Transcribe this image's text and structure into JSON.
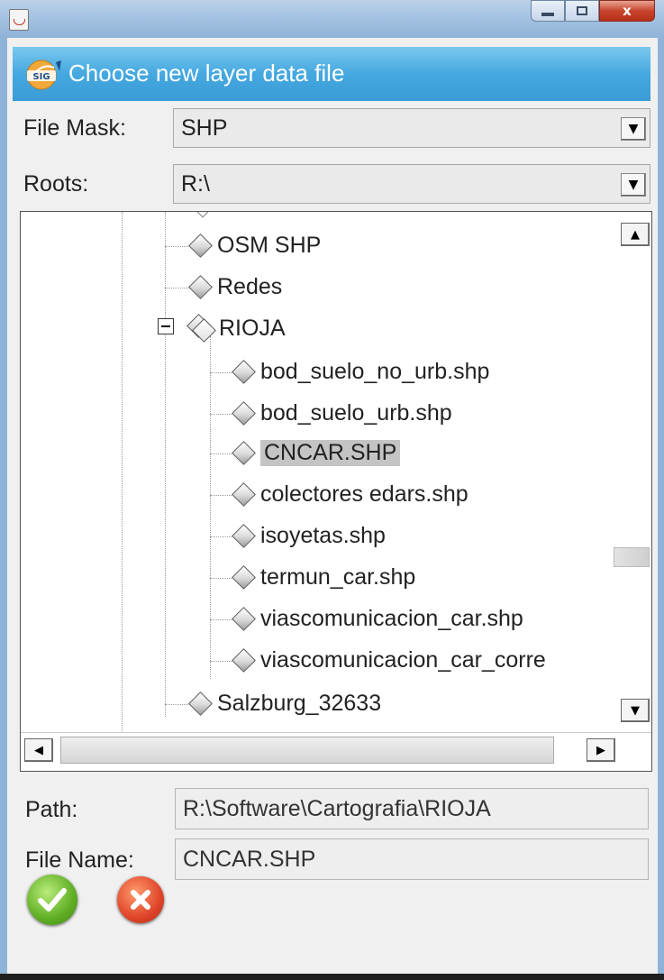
{
  "window": {
    "controls": {
      "minimize": "minimize-icon",
      "maximize": "maximize-icon",
      "close": "close-icon",
      "close_glyph": "x"
    }
  },
  "dialog": {
    "title": "Choose new layer data file",
    "logo_text": "SIG"
  },
  "filters": {
    "file_mask_label": "File Mask:",
    "file_mask_value": "SHP",
    "roots_label": "Roots:",
    "roots_value": "R:\\"
  },
  "tree": {
    "items": [
      {
        "label": "OSM SHP",
        "level": 1
      },
      {
        "label": "Redes",
        "level": 1
      },
      {
        "label": "RIOJA",
        "level": 1,
        "expanded": true
      },
      {
        "label": "bod_suelo_no_urb.shp",
        "level": 2
      },
      {
        "label": "bod_suelo_urb.shp",
        "level": 2
      },
      {
        "label": "CNCAR.SHP",
        "level": 2,
        "selected": true
      },
      {
        "label": "colectores edars.shp",
        "level": 2
      },
      {
        "label": "isoyetas.shp",
        "level": 2
      },
      {
        "label": "termun_car.shp",
        "level": 2
      },
      {
        "label": "viascomunicacion_car.shp",
        "level": 2
      },
      {
        "label": "viascomunicacion_car_corre",
        "level": 2
      },
      {
        "label": "Salzburg_32633",
        "level": 1
      }
    ],
    "scroll": {
      "up": "▲",
      "down": "▼",
      "left": "◀",
      "right": "▶"
    }
  },
  "path": {
    "label": "Path:",
    "value": "R:\\Software\\Cartografia\\RIOJA"
  },
  "file_name": {
    "label": "File Name:",
    "value": "CNCAR.SHP"
  },
  "actions": {
    "ok_icon": "check-icon",
    "cancel_icon": "x-icon"
  },
  "colors": {
    "header": "#45a8e0",
    "selection": "#c4c4c4",
    "ok": "#5fae24",
    "cancel": "#e0452a"
  }
}
